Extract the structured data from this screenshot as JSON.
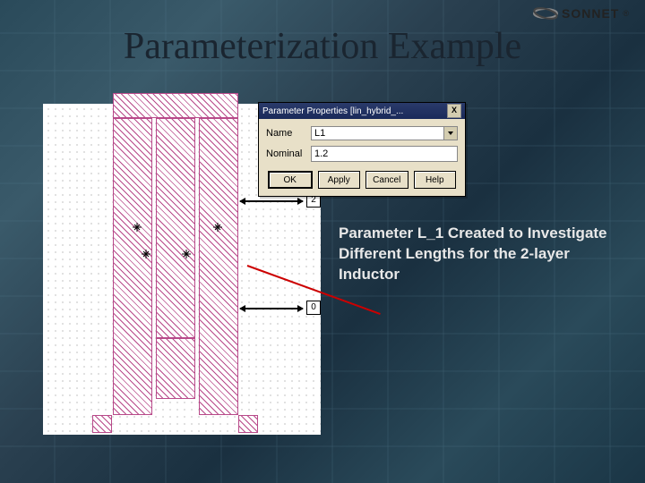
{
  "logo": {
    "text": "SONNET",
    "reg": "®"
  },
  "title": "Parameterization Example",
  "dialog": {
    "title": "Parameter Properties [lin_hybrid_...",
    "name_label": "Name",
    "name_value": "L1",
    "nominal_label": "Nominal",
    "nominal_value": "1.2",
    "buttons": {
      "ok": "OK",
      "apply": "Apply",
      "cancel": "Cancel",
      "help": "Help"
    },
    "close": "X"
  },
  "markers": {
    "top_num": "2",
    "bottom_num": "0"
  },
  "caption": "Parameter L_1 Created to Investigate Different Lengths for the 2-layer Inductor"
}
